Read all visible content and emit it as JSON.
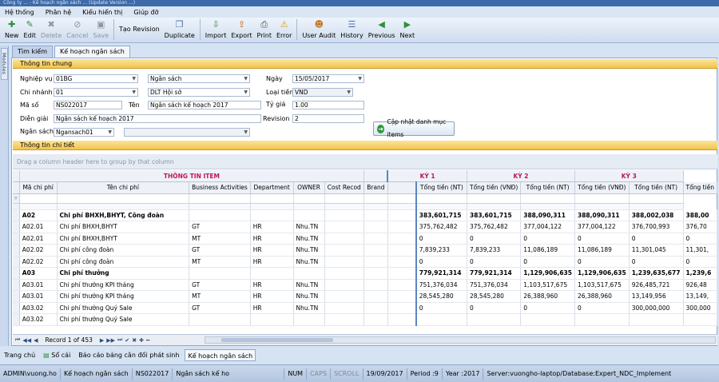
{
  "window": {
    "title": "Công ty ... - Kế hoạch ngân sách ... (Update Version ...)"
  },
  "menu": [
    "Hệ thống",
    "Phân hệ",
    "Kiểu hiển thị",
    "Giúp đỡ"
  ],
  "toolbar": [
    {
      "label": "New",
      "icon": "new-icon",
      "glyph": "✚",
      "color": "#2f8f3c",
      "enabled": true
    },
    {
      "label": "Edit",
      "icon": "edit-icon",
      "glyph": "✎",
      "color": "#2f8f3c",
      "enabled": true
    },
    {
      "label": "Delete",
      "icon": "delete-icon",
      "glyph": "✖",
      "color": "#8c96a3",
      "enabled": false
    },
    {
      "label": "Cancel",
      "icon": "cancel-icon",
      "glyph": "⊘",
      "color": "#8c96a3",
      "enabled": false
    },
    {
      "label": "Save",
      "icon": "save-icon",
      "glyph": "▣",
      "color": "#8c96a3",
      "enabled": false
    },
    {
      "label": "Tạo Revision",
      "icon": "",
      "glyph": "",
      "color": "#000",
      "enabled": true
    },
    {
      "label": "Duplicate",
      "icon": "duplicate-icon",
      "glyph": "❐",
      "color": "#4a6fa5",
      "enabled": true
    },
    {
      "label": "Import",
      "icon": "import-icon",
      "glyph": "⇩",
      "color": "#2f8f3c",
      "enabled": true
    },
    {
      "label": "Export",
      "icon": "export-icon",
      "glyph": "⇪",
      "color": "#c9661a",
      "enabled": true
    },
    {
      "label": "Print",
      "icon": "print-icon",
      "glyph": "⎙",
      "color": "#4a4a4a",
      "enabled": true
    },
    {
      "label": "Error",
      "icon": "error-icon",
      "glyph": "⚠",
      "color": "#d99a00",
      "enabled": true
    },
    {
      "label": "User Audit",
      "icon": "user-audit-icon",
      "glyph": "☻",
      "color": "#c67a2a",
      "enabled": true
    },
    {
      "label": "History",
      "icon": "history-icon",
      "glyph": "☰",
      "color": "#4a6fa5",
      "enabled": true
    },
    {
      "label": "Previous",
      "icon": "previous-icon",
      "glyph": "◀",
      "color": "#2f8f3c",
      "enabled": true
    },
    {
      "label": "Next",
      "icon": "next-icon",
      "glyph": "▶",
      "color": "#2f8f3c",
      "enabled": true
    }
  ],
  "side": {
    "modules": "Modules"
  },
  "tabs": [
    "Tìm kiếm",
    "Kế hoạch ngân sách"
  ],
  "general": {
    "header": "Thông tin chung",
    "nghiep_vu_label": "Nghiệp vụ",
    "nghiep_vu_code": "01BG",
    "nghiep_vu_name": "Ngân sách",
    "ngay_label": "Ngày",
    "ngay": "15/05/2017",
    "chi_nhanh_label": "Chi nhánh",
    "chi_nhanh_code": "01",
    "chi_nhanh_name": "DLT Hội sở",
    "loai_tien_label": "Loại tiền",
    "loai_tien": "VND",
    "ma_so_label": "Mã số",
    "ma_so": "NS022017",
    "ten_label": "Tên",
    "ten": "Ngân sách kế hoạch 2017",
    "ty_gia_label": "Tỷ giá",
    "ty_gia": "1.00",
    "dien_giai_label": "Diễn giải",
    "dien_giai": "Ngân sách kế hoạch 2017",
    "revision_label": "Revision",
    "revision": "2",
    "ngan_sach_label": "Ngân sách",
    "ngan_sach": "Ngansach01",
    "update_button": "Cập nhật danh mục items"
  },
  "detail": {
    "header": "Thông tin chi tiết",
    "group_hint": "Drag a column header here to group by that column"
  },
  "grid": {
    "band_item": "THÔNG TIN ITEM",
    "band_k1": "KỲ 1",
    "band_k2": "KỲ 2",
    "band_k3": "KỲ 3",
    "columns": [
      "Mã chi phí",
      "Tên chi phí",
      "Business Activities",
      "Department",
      "OWNER",
      "Cost Recod",
      "Brand",
      "Tổng tiền (NT)",
      "Tổng tiền (VNĐ)",
      "Tổng tiền (NT)",
      "Tổng tiền (VNĐ)",
      "Tổng tiền (NT)",
      "Tổng tiền"
    ],
    "rows": [
      {
        "bold": true,
        "cells": [
          "A02",
          "Chi phí BHXH,BHYT, Công đoàn",
          "",
          "",
          "",
          "",
          "",
          "383,601,715",
          "383,601,715",
          "388,090,311",
          "388,090,311",
          "388,002,038",
          "388,00"
        ]
      },
      {
        "bold": false,
        "cells": [
          "A02.01",
          "Chi phí BHXH,BHYT",
          "GT",
          "HR",
          "Nhu.TN",
          "",
          "",
          "375,762,482",
          "375,762,482",
          "377,004,122",
          "377,004,122",
          "376,700,993",
          "376,70"
        ]
      },
      {
        "bold": false,
        "cells": [
          "A02.01",
          "Chi phí BHXH,BHYT",
          "MT",
          "HR",
          "Nhu.TN",
          "",
          "",
          "0",
          "0",
          "0",
          "0",
          "0",
          "0"
        ]
      },
      {
        "bold": false,
        "cells": [
          "A02.02",
          "Chi phí công đoàn",
          "GT",
          "HR",
          "Nhu.TN",
          "",
          "",
          "7,839,233",
          "7,839,233",
          "11,086,189",
          "11,086,189",
          "11,301,045",
          "11,301,"
        ]
      },
      {
        "bold": false,
        "cells": [
          "A02.02",
          "Chi phí công đoàn",
          "MT",
          "HR",
          "Nhu.TN",
          "",
          "",
          "0",
          "0",
          "0",
          "0",
          "0",
          "0"
        ]
      },
      {
        "bold": true,
        "cells": [
          "A03",
          "Chi phí thưởng",
          "",
          "",
          "",
          "",
          "",
          "779,921,314",
          "779,921,314",
          "1,129,906,635",
          "1,129,906,635",
          "1,239,635,677",
          "1,239,6"
        ]
      },
      {
        "bold": false,
        "cells": [
          "A03.01",
          "Chi phí thưởng KPI tháng",
          "GT",
          "HR",
          "Nhu.TN",
          "",
          "",
          "751,376,034",
          "751,376,034",
          "1,103,517,675",
          "1,103,517,675",
          "926,485,721",
          "926,48"
        ]
      },
      {
        "bold": false,
        "cells": [
          "A03.01",
          "Chi phí thưởng KPI tháng",
          "MT",
          "HR",
          "Nhu.TN",
          "",
          "",
          "28,545,280",
          "28,545,280",
          "26,388,960",
          "26,388,960",
          "13,149,956",
          "13,149,"
        ]
      },
      {
        "bold": false,
        "cells": [
          "A03.02",
          "Chi phí thưởng Quý Sale",
          "GT",
          "HR",
          "Nhu.TN",
          "",
          "",
          "0",
          "0",
          "0",
          "0",
          "300,000,000",
          "300,000"
        ]
      },
      {
        "bold": false,
        "cells": [
          "A03.02",
          "Chi phí thưởng Quý Sale",
          "",
          "",
          "",
          "",
          "",
          "",
          "",
          "",
          "",
          "",
          ""
        ]
      }
    ]
  },
  "navigator": {
    "record": "Record 1 of 453"
  },
  "doc_tabs": [
    "Trang chủ",
    "Sổ cái",
    "Báo cáo bảng cân đối phát sinh",
    "Kế hoạch ngân sách"
  ],
  "status": {
    "user": "ADMIN\\vuong.ho",
    "form": "Kế hoạch ngân sách",
    "code": "NS022017",
    "name": "Ngân sách kế ho",
    "num": "NUM",
    "caps": "CAPS",
    "scroll": "SCROLL",
    "date": "19/09/2017",
    "period": "Period :9",
    "year": "Year :2017",
    "server": "Server:vuongho-laptop/Database:Expert_NDC_Implement"
  }
}
